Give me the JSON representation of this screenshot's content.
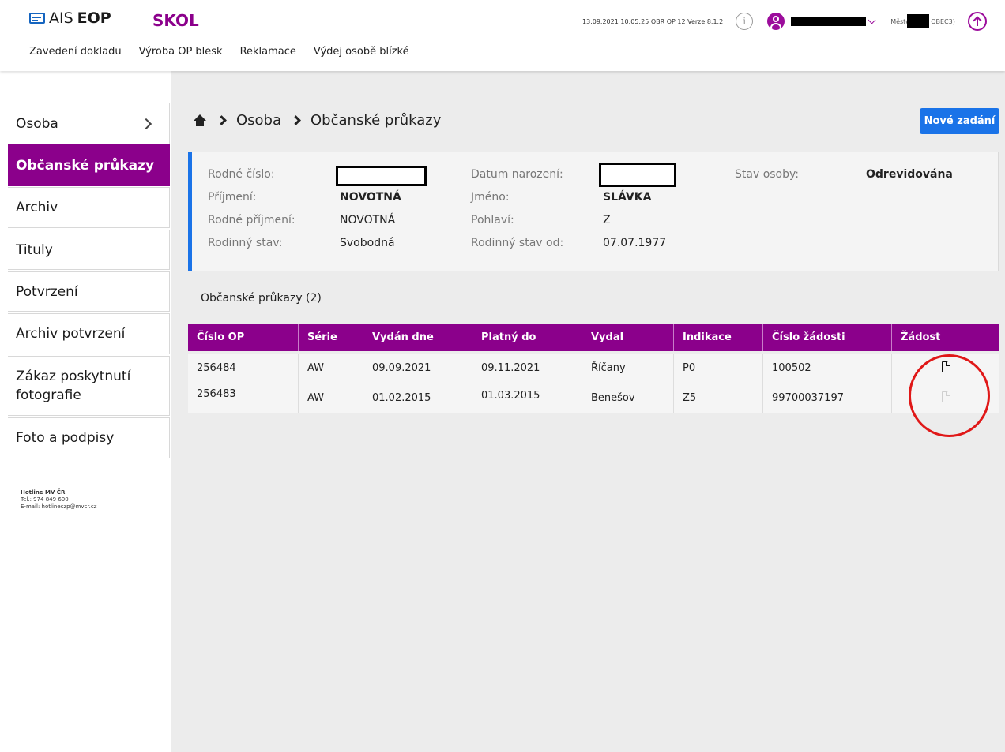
{
  "header": {
    "logo_prefix": "AIS",
    "logo_suffix": "EOP",
    "app_name": "SKOL",
    "version_info": "13.09.2021 10:05:25 OBR OP 12 Verze 8.1.2",
    "mesto_label": "Město",
    "mesto_code": "OBEC3)",
    "nav": [
      "Zavedení dokladu",
      "Výroba OP blesk",
      "Reklamace",
      "Výdej osobě blízké"
    ]
  },
  "sidebar": {
    "items": [
      {
        "label": "Osoba",
        "active": false,
        "has_arrow": true
      },
      {
        "label": "Občanské průkazy",
        "active": true
      },
      {
        "label": "Archiv",
        "active": false
      },
      {
        "label": "Tituly",
        "active": false
      },
      {
        "label": "Potvrzení",
        "active": false
      },
      {
        "label": "Archiv potvrzení",
        "active": false
      },
      {
        "label": "Zákaz poskytnutí fotografie",
        "active": false
      },
      {
        "label": "Foto a podpisy",
        "active": false
      }
    ],
    "hotline": {
      "title": "Hotline MV ČR",
      "tel": "Tel.: 974 849 600",
      "email": "E-mail: hotlineczp@mvcr.cz"
    }
  },
  "breadcrumb": [
    "Osoba",
    "Občanské průkazy"
  ],
  "new_button_label": "Nové zadání",
  "person": {
    "rodne_cislo_label": "Rodné číslo:",
    "prijmeni_label": "Příjmení:",
    "prijmeni": "NOVOTNÁ",
    "rodne_prijmeni_label": "Rodné příjmení:",
    "rodne_prijmeni": "NOVOTNÁ",
    "rodinny_stav_label": "Rodinný stav:",
    "rodinny_stav": "Svobodná",
    "datum_narozeni_label": "Datum narození:",
    "jmeno_label": "Jméno:",
    "jmeno": "SLÁVKA",
    "pohlavi_label": "Pohlaví:",
    "pohlavi": "Z",
    "rodinny_stav_od_label": "Rodinný stav od:",
    "rodinny_stav_od": "07.07.1977",
    "stav_osoby_label": "Stav osoby:",
    "stav_osoby": "Odrevidována"
  },
  "section_title": "Občanské průkazy (2)",
  "table": {
    "columns": [
      "Číslo OP",
      "Série",
      "Vydán dne",
      "Platný do",
      "Vydal",
      "Indikace",
      "Číslo žádosti",
      "Žádost"
    ],
    "rows": [
      {
        "cislo_op": "256484",
        "serie": "AW",
        "vydan_dne": "09.09.2021",
        "platny_do": "09.11.2021",
        "vydal": "Říčany",
        "indikace": "P0",
        "cislo_zadosti": "100502",
        "zadost_icon": "document-icon",
        "zadost_enabled": true
      },
      {
        "cislo_op": "256483",
        "serie": "AW",
        "vydan_dne": "01.02.2015",
        "platny_do": "01.03.2015",
        "vydal": "Benešov",
        "indikace": "Z5",
        "cislo_zadosti": "99700037197",
        "zadost_icon": "document-icon",
        "zadost_enabled": false
      }
    ]
  },
  "colors": {
    "brand_purple": "#8b008b",
    "primary_blue": "#1a73e8",
    "annotation_red": "#e01818"
  }
}
